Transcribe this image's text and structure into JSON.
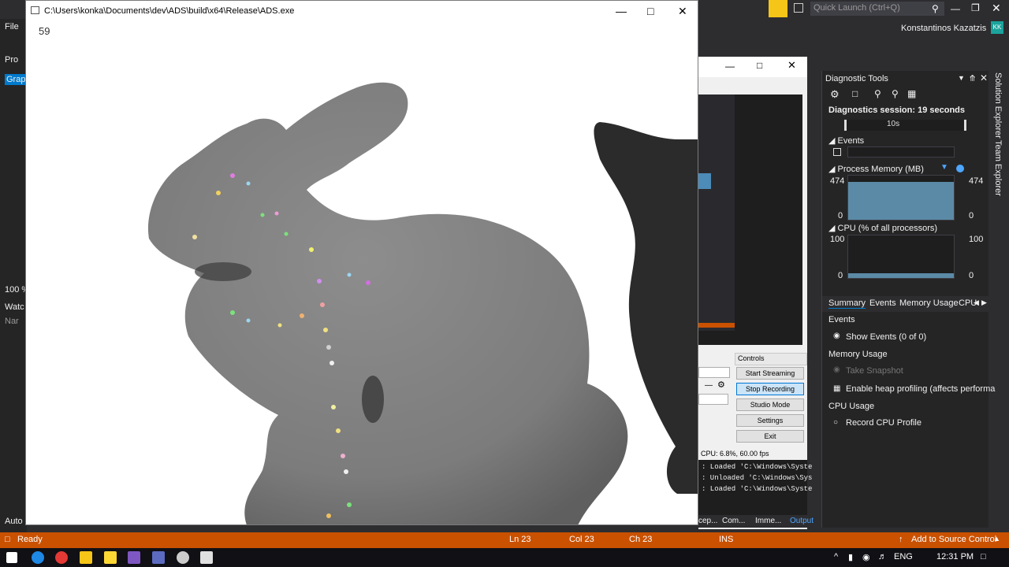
{
  "app_window": {
    "title": "C:\\Users\\konka\\Documents\\dev\\ADS\\build\\x64\\Release\\ADS.exe",
    "fps": "59"
  },
  "vs": {
    "menu_file": "File",
    "quick_launch_placeholder": "Quick Launch (Ctrl+Q)",
    "user_name": "Konstantinos Kazatzis",
    "user_initials": "KK",
    "left_labels": [
      "Pro",
      "Grap",
      "100 %",
      "Watc",
      "Nar",
      "Auto"
    ],
    "side_tabs": [
      "Solution Explorer",
      "Team Explorer"
    ]
  },
  "diagnostics": {
    "title": "Diagnostic Tools",
    "session": "Diagnostics session: 19 seconds",
    "timeline_label": "10s",
    "events_header": "Events",
    "memory_header": "Process Memory (MB)",
    "memory_max": "474",
    "memory_min": "0",
    "memory_level": 0.85,
    "cpu_header": "CPU (% of all processors)",
    "cpu_max": "100",
    "cpu_min": "0",
    "tabs": [
      "Summary",
      "Events",
      "Memory Usage",
      "CPU"
    ],
    "sections": {
      "events": "Events",
      "show_events": "Show Events (0 of 0)",
      "memory_usage": "Memory Usage",
      "take_snapshot": "Take Snapshot",
      "heap_profiling": "Enable heap profiling (affects performa",
      "cpu_usage": "CPU Usage",
      "record_cpu": "Record CPU Profile"
    }
  },
  "obs": {
    "controls_label": "Controls",
    "buttons": [
      "Start Streaming",
      "Stop Recording",
      "Studio Mode",
      "Settings",
      "Exit"
    ],
    "status": "CPU: 6.8%, 60.00 fps"
  },
  "output": {
    "lines": [
      ": Loaded 'C:\\Windows\\Syste",
      ": Unloaded 'C:\\Windows\\Sys",
      ": Loaded 'C:\\Windows\\Syste"
    ],
    "tabs": [
      "cep...",
      "Com...",
      "Imme...",
      "Output"
    ]
  },
  "status_bar": {
    "ready": "Ready",
    "ln": "Ln 23",
    "col": "Col 23",
    "ch": "Ch 23",
    "ins": "INS",
    "source_control": "Add to Source Control"
  },
  "taskbar": {
    "language": "ENG",
    "time": "12:31 PM"
  },
  "colors": {
    "vs_accent": "#ca5100",
    "graph_fill": "#5b8aa6",
    "bunny": "#7f7f7f"
  }
}
